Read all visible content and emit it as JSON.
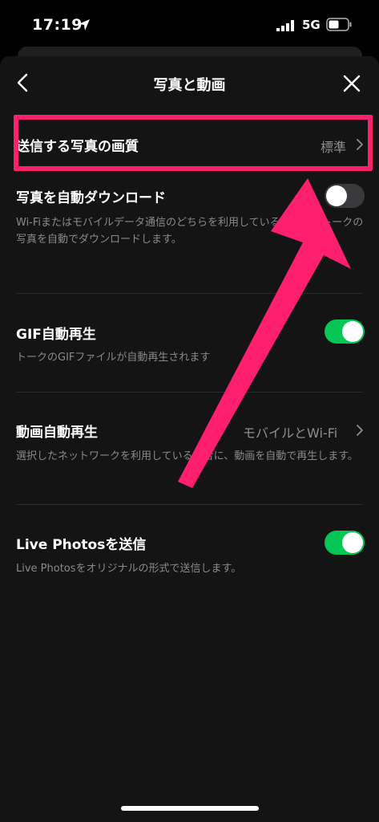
{
  "status_bar": {
    "time": "17:19",
    "network": "5G"
  },
  "nav": {
    "title": "写真と動画"
  },
  "rows": [
    {
      "title": "送信する写真の画質",
      "value": "標準"
    },
    {
      "title": "写真を自動ダウンロード",
      "desc": "Wi-Fiまたはモバイルデータ通信のどちらを利用している時でも、トークの写真を自動でダウンロードします。",
      "toggle": "off"
    },
    {
      "title": "GIF自動再生",
      "desc": "トークのGIFファイルが自動再生されます",
      "toggle": "on"
    },
    {
      "title": "動画自動再生",
      "value": "モバイルとWi-Fi",
      "desc": "選択したネットワークを利用している場合に、動画を自動で再生します。"
    },
    {
      "title": "Live Photosを送信",
      "desc": "Live Photosをオリジナルの形式で送信します。",
      "toggle": "on"
    }
  ],
  "colors": {
    "toggle_on": "#06c755",
    "toggle_off": "#3a3a3c",
    "annotation": "#ff1f6f"
  }
}
